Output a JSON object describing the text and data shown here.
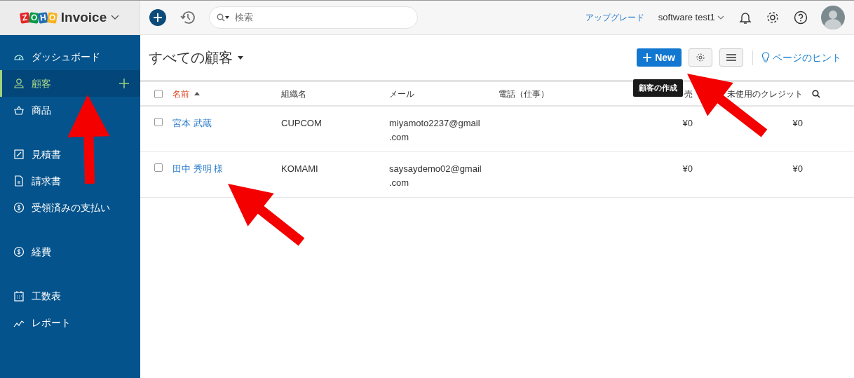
{
  "topbar": {
    "logo_letters": [
      "Z",
      "O",
      "H",
      "O"
    ],
    "product": "Invoice",
    "search": {
      "placeholder": "検索"
    },
    "upgrade": "アップグレード",
    "organization": "software test1"
  },
  "sidebar": {
    "groups": [
      [
        {
          "label": "ダッシュボード",
          "selected": false
        },
        {
          "label": "顧客",
          "selected": true
        },
        {
          "label": "商品",
          "selected": false
        }
      ],
      [
        {
          "label": "見積書",
          "selected": false
        },
        {
          "label": "請求書",
          "selected": false
        },
        {
          "label": "受領済みの支払い",
          "selected": false
        }
      ],
      [
        {
          "label": "経費",
          "selected": false
        }
      ],
      [
        {
          "label": "工数表",
          "selected": false
        },
        {
          "label": "レポート",
          "selected": false
        }
      ]
    ]
  },
  "header": {
    "title": "すべての顧客",
    "new_button": "New",
    "tooltip": "顧客の作成",
    "hint": "ページのヒント"
  },
  "table": {
    "select_all": {
      "checked": false
    },
    "columns": [
      {
        "label": "名前",
        "sorted": true,
        "kind": "text"
      },
      {
        "label": "組織名",
        "sorted": false,
        "kind": "text"
      },
      {
        "label": "メール",
        "sorted": false,
        "kind": "text"
      },
      {
        "label": "電話（仕事）",
        "sorted": false,
        "kind": "text"
      },
      {
        "label": "売",
        "sorted": false,
        "kind": "amount"
      },
      {
        "label": "未使用のクレジット",
        "sorted": false,
        "kind": "amount"
      }
    ],
    "rows": [
      {
        "checked": false,
        "cells": [
          "宮本 武蔵",
          "CUPCOM",
          "miyamoto2237@gmail.com",
          "",
          "¥0",
          "¥0"
        ]
      },
      {
        "checked": false,
        "cells": [
          "田中 秀明 様",
          "KOMAMI",
          "saysaydemo02@gmail.com",
          "",
          "¥0",
          "¥0"
        ]
      }
    ]
  }
}
